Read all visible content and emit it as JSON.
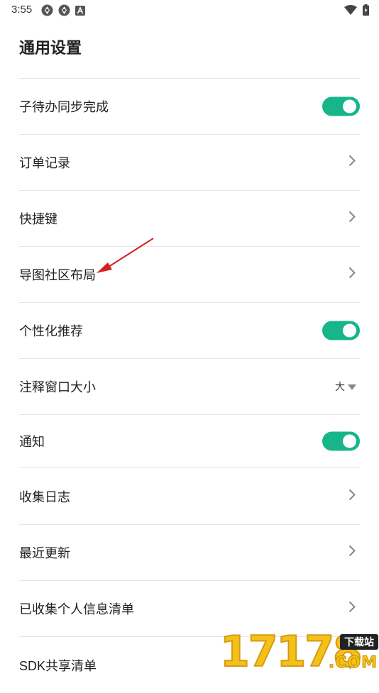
{
  "status_bar": {
    "time": "3:55",
    "left_icons": [
      "sync-icon",
      "sync-icon",
      "app-notification-icon"
    ],
    "right_icons": [
      "wifi-icon",
      "battery-charging-icon"
    ]
  },
  "page": {
    "title": "通用设置"
  },
  "settings": [
    {
      "label": "子待办同步完成",
      "control": "toggle",
      "enabled": true
    },
    {
      "label": "订单记录",
      "control": "chevron"
    },
    {
      "label": "快捷键",
      "control": "chevron"
    },
    {
      "label": "导图社区布局",
      "control": "chevron"
    },
    {
      "label": "个性化推荐",
      "control": "toggle",
      "enabled": true
    },
    {
      "label": "注释窗口大小",
      "control": "select",
      "value": "大"
    },
    {
      "label": "通知",
      "control": "toggle",
      "enabled": true
    },
    {
      "label": "收集日志",
      "control": "chevron"
    },
    {
      "label": "最近更新",
      "control": "chevron"
    },
    {
      "label": "已收集个人信息清单",
      "control": "chevron"
    },
    {
      "label": "SDK共享清单",
      "control": "chevron"
    }
  ],
  "colors": {
    "toggle_on": "#16b68a",
    "annotation_arrow": "#d61f1f",
    "divider": "#e6e6e6"
  },
  "watermark": {
    "digits": "17178",
    "badge": "下载站",
    "domain": ".COM"
  }
}
